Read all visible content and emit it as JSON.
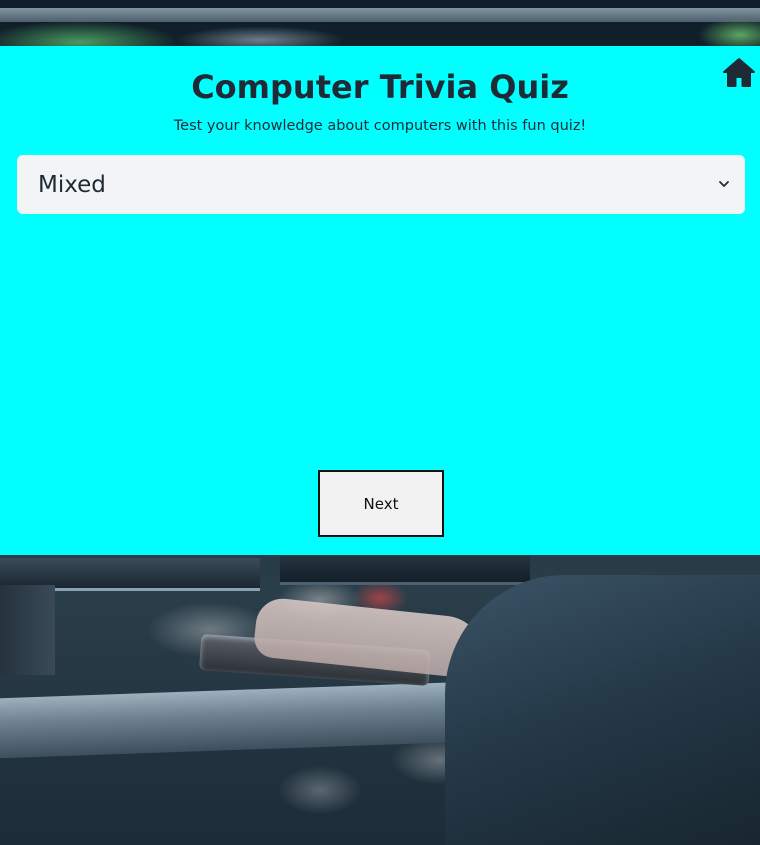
{
  "header": {
    "title": "Computer Trivia Quiz",
    "subtitle": "Test your knowledge about computers with this fun quiz!",
    "home_icon": "home-icon"
  },
  "category_select": {
    "selected": "Mixed",
    "chevron_icon": "chevron-down-icon"
  },
  "actions": {
    "next_label": "Next"
  },
  "colors": {
    "panel_bg": "#00ffff",
    "text": "#1e2a35",
    "select_bg": "#f3f4f6",
    "button_bg": "#f2f2f2"
  }
}
